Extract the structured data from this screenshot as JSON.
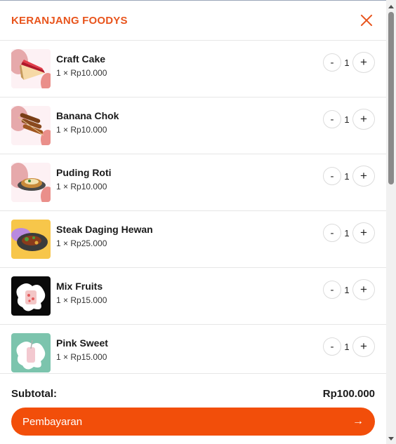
{
  "cart": {
    "title": "KERANJANG FOODYS",
    "items": [
      {
        "name": "Craft Cake",
        "price": "1 × Rp10.000",
        "qty": "1"
      },
      {
        "name": "Banana Chok",
        "price": "1 × Rp10.000",
        "qty": "1"
      },
      {
        "name": "Puding Roti",
        "price": "1 × Rp10.000",
        "qty": "1"
      },
      {
        "name": "Steak Daging Hewan",
        "price": "1 × Rp25.000",
        "qty": "1"
      },
      {
        "name": "Mix Fruits",
        "price": "1 × Rp15.000",
        "qty": "1"
      },
      {
        "name": "Pink Sweet",
        "price": "1 × Rp15.000",
        "qty": "1"
      }
    ],
    "minus_label": "-",
    "plus_label": "+"
  },
  "footer": {
    "subtotal_label": "Subtotal:",
    "subtotal_value": "Rp100.000",
    "pay_label": "Pembayaran",
    "pay_arrow": "→"
  },
  "colors": {
    "accent": "#e8541c",
    "pay_button": "#f24e0a"
  }
}
